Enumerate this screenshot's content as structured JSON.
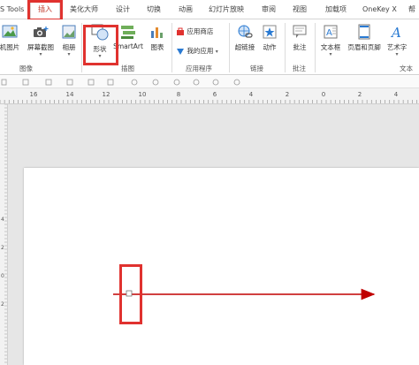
{
  "tabs": [
    {
      "label": "Tools",
      "prefix": "S"
    },
    {
      "label": "插入"
    },
    {
      "label": "美化大师"
    },
    {
      "label": "设计"
    },
    {
      "label": "切换"
    },
    {
      "label": "动画"
    },
    {
      "label": "幻灯片放映"
    },
    {
      "label": "审阅"
    },
    {
      "label": "视图"
    },
    {
      "label": "加载项"
    },
    {
      "label": "OneKey X"
    },
    {
      "label": "帮"
    }
  ],
  "ribbon": {
    "images": {
      "btn_pc_image": "机图片",
      "btn_screenshot": "屏幕截图",
      "btn_album": "相册",
      "group_label": "图像"
    },
    "illustrations": {
      "btn_shapes": "形状",
      "btn_smartart": "SmartArt",
      "btn_chart": "图表",
      "group_label": "插图"
    },
    "apps": {
      "btn_store": "应用商店",
      "btn_myapps": "我的应用",
      "group_label": "应用程序"
    },
    "links": {
      "btn_hyperlink": "超链接",
      "btn_action": "动作",
      "group_label": "链接"
    },
    "comments": {
      "btn_comment": "批注",
      "group_label": "批注"
    },
    "text": {
      "btn_textbox": "文本框",
      "btn_header_footer": "页眉和页脚",
      "btn_wordart": "艺术字",
      "group_label": "文本"
    }
  },
  "ruler": {
    "h_labels": [
      "16",
      "14",
      "12",
      "10",
      "8",
      "6",
      "4",
      "2",
      "0",
      "2",
      "4"
    ],
    "v_labels": [
      "4",
      "2",
      "0",
      "2"
    ]
  },
  "colors": {
    "accent": "#c0392b",
    "highlight_box": "#e0322f",
    "arrow": "#c00000"
  }
}
